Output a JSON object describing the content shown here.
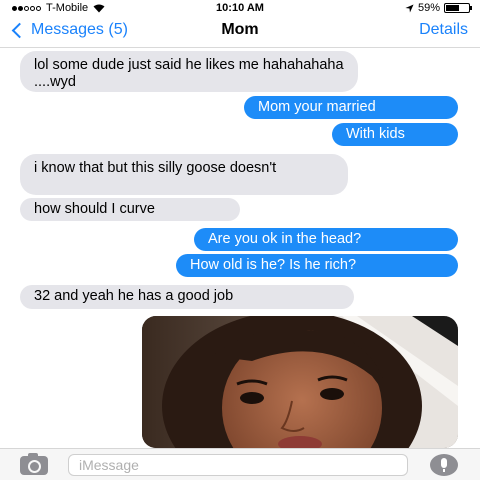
{
  "status_bar": {
    "carrier": "T-Mobile",
    "time": "10:10 AM",
    "battery": "59%",
    "battery_level": 0.59,
    "signal_bars": 2
  },
  "nav": {
    "back_label": "Messages (5)",
    "title": "Mom",
    "details_label": "Details"
  },
  "messages": [
    {
      "sender": "contact",
      "text": "lol some dude just said he likes me hahahahaha ....wyd"
    },
    {
      "sender": "me",
      "text": "Mom your married"
    },
    {
      "sender": "me",
      "text": "With kids"
    },
    {
      "sender": "contact",
      "text": "i know that but this silly goose doesn't"
    },
    {
      "sender": "contact",
      "text": "how should I curve"
    },
    {
      "sender": "me",
      "text": "Are you ok in the head?"
    },
    {
      "sender": "me",
      "text": "How old is he? Is he rich?"
    },
    {
      "sender": "contact",
      "text": "32 and yeah he has a good job"
    }
  ],
  "input": {
    "placeholder": "iMessage"
  },
  "colors": {
    "accent": "#1a82fb",
    "outgoing_bubble": "#1d8cf8",
    "incoming_bubble": "#e5e5ea"
  }
}
